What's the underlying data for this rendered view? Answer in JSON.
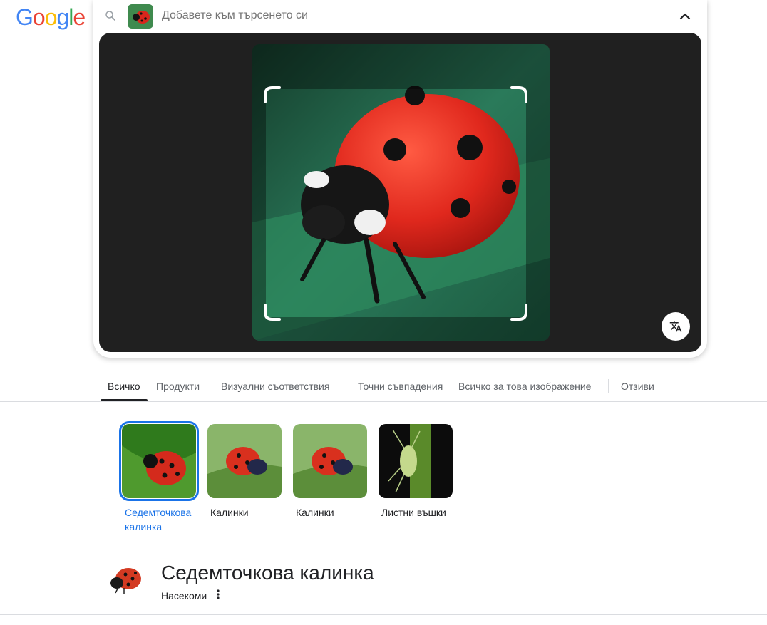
{
  "logo": {
    "letters": [
      "G",
      "o",
      "o",
      "g",
      "l",
      "e"
    ],
    "colors": [
      "#4285F4",
      "#EA4335",
      "#FBBC05",
      "#4285F4",
      "#34A853",
      "#EA4335"
    ]
  },
  "search": {
    "placeholder": "Добавете към търсенето си",
    "icon": "search-icon",
    "collapse_icon": "chevron-up-icon"
  },
  "image_viewer": {
    "translate_icon": "translate-icon"
  },
  "tabs": [
    {
      "label": "Всичко",
      "active": true
    },
    {
      "label": "Продукти",
      "active": false
    },
    {
      "label": "Визуални съответствия",
      "active": false
    },
    {
      "label": "Точни съвпадения",
      "active": false
    },
    {
      "label": "Всичко за това изображение",
      "active": false
    },
    {
      "label": "Отзиви",
      "active": false
    }
  ],
  "entities": [
    {
      "label": "Седемточкова калинка",
      "selected": true
    },
    {
      "label": "Калинки",
      "selected": false
    },
    {
      "label": "Калинки",
      "selected": false
    },
    {
      "label": "Листни въшки",
      "selected": false
    }
  ],
  "knowledge_panel": {
    "title": "Седемточкова калинка",
    "subtitle": "Насекоми",
    "more_icon": "more-vert-icon"
  },
  "colors": {
    "accent": "#1a73e8",
    "stage_bg": "#202020"
  }
}
